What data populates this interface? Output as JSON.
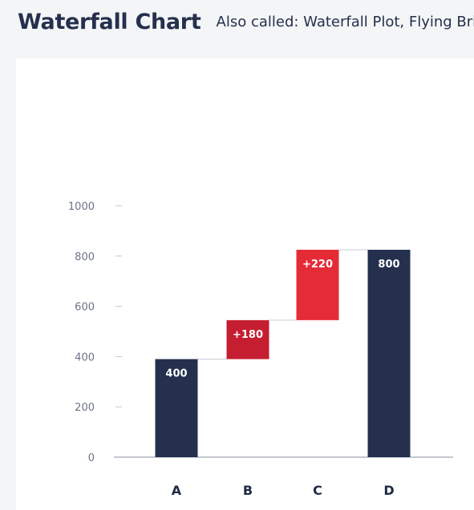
{
  "header": {
    "title": "Waterfall Chart",
    "subtitle": "Also called: Waterfall Plot, Flying Bricks Chart"
  },
  "chart_data": {
    "type": "bar",
    "subtype": "waterfall",
    "categories": [
      "A",
      "B",
      "C",
      "D"
    ],
    "bars": [
      {
        "category": "A",
        "kind": "total",
        "start": 0,
        "end": 390,
        "label": "400",
        "color": "#25304f"
      },
      {
        "category": "B",
        "kind": "increase",
        "start": 390,
        "end": 545,
        "label": "+180",
        "color": "#c41e30"
      },
      {
        "category": "C",
        "kind": "increase",
        "start": 545,
        "end": 825,
        "label": "+220",
        "color": "#e52b36"
      },
      {
        "category": "D",
        "kind": "total",
        "start": 0,
        "end": 825,
        "label": "800",
        "color": "#25304f"
      }
    ],
    "y_ticks": [
      "0",
      "200",
      "400",
      "600",
      "800",
      "1000"
    ],
    "y_tick_values": [
      0,
      200,
      400,
      600,
      800,
      1000
    ],
    "ylim": [
      0,
      1000
    ],
    "connector_color": "#c8ccd4",
    "grid": false
  }
}
